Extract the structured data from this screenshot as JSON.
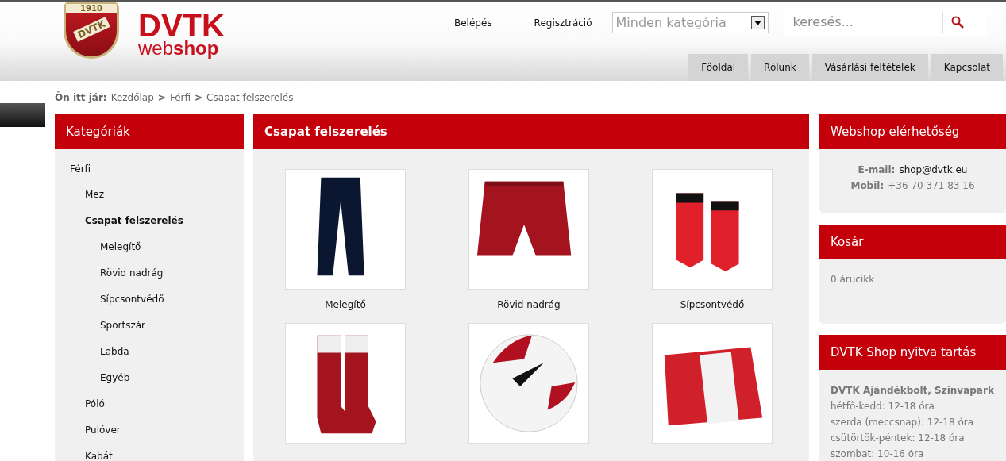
{
  "logo": {
    "crest_year": "1910",
    "crest_text": "DVTK",
    "title": "DVTK",
    "subtitle": "web**shop**"
  },
  "top_links": [
    "Belépés",
    "Regisztráció"
  ],
  "category_select": {
    "value": "Minden kategória"
  },
  "search": {
    "placeholder": "keresés..."
  },
  "menu": [
    {
      "label": "Főoldal"
    },
    {
      "label": "Rólunk"
    },
    {
      "label": "Vásárlási feltételek"
    },
    {
      "label": "Kapcsolat"
    }
  ],
  "breadcrumb": {
    "prefix": "Ön itt jár:",
    "items": [
      "Kezdőlap",
      "Férfi",
      "Csapat felszerelés"
    ],
    "separator": ">"
  },
  "sidebar": {
    "title": "Kategóriák",
    "items": [
      {
        "label": "Férfi",
        "selected": false,
        "children": [
          {
            "label": "Mez",
            "selected": false
          },
          {
            "label": "Csapat felszerelés",
            "selected": true,
            "children": [
              {
                "label": "Melegítő",
                "selected": false
              },
              {
                "label": "Rövid nadrág",
                "selected": false
              },
              {
                "label": "Sípcsontvédő",
                "selected": false
              },
              {
                "label": "Sportszár",
                "selected": false
              },
              {
                "label": "Labda",
                "selected": false
              },
              {
                "label": "Egyéb",
                "selected": false
              }
            ]
          },
          {
            "label": "Póló",
            "selected": false
          },
          {
            "label": "Pulóver",
            "selected": false
          },
          {
            "label": "Kabát",
            "selected": false
          }
        ]
      }
    ]
  },
  "content": {
    "title": "Csapat felszerelés",
    "products": [
      {
        "label": "Melegítő",
        "kind": "pants"
      },
      {
        "label": "Rövid nadrág",
        "kind": "shorts"
      },
      {
        "label": "Sípcsontvédő",
        "kind": "shinguards"
      },
      {
        "kind": "socks"
      },
      {
        "kind": "ball"
      },
      {
        "kind": "scarf"
      }
    ]
  },
  "right_boxes": [
    {
      "kind": "contact",
      "title": "Webshop elérhetőség",
      "lines": [
        {
          "label": "E-mail:",
          "value": "shop@dvtk.eu",
          "link": true
        },
        {
          "label": "Mobil:",
          "value": "+36 70 371 83 16",
          "link": false
        }
      ]
    },
    {
      "kind": "cart",
      "title": "Kosár",
      "text": "0 árucikk"
    },
    {
      "kind": "hours",
      "title": "DVTK Shop nyitva tartás",
      "heading": "DVTK Ajándékbolt, Szinvapark",
      "lines": [
        "hétfő-kedd: 12-18 óra",
        "szerda (meccsnap): 12-18 óra",
        "csütörtök-péntek: 12-18 óra",
        "szombat: 10-16 óra"
      ]
    }
  ]
}
